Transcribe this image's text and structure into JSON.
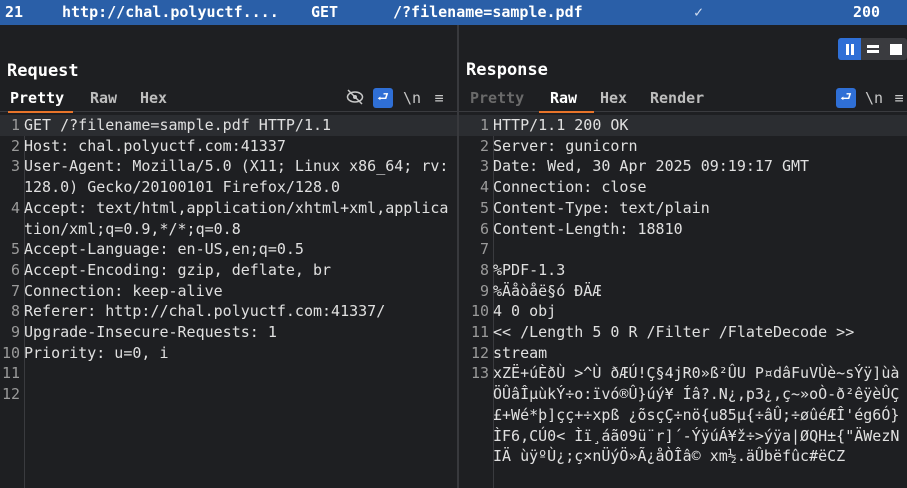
{
  "history_row": {
    "id": "21",
    "host": "http://chal.polyuctf....",
    "method": "GET",
    "url": "/?filename=sample.pdf",
    "status": "200"
  },
  "request": {
    "title": "Request",
    "tabs": [
      "Pretty",
      "Raw",
      "Hex"
    ],
    "newline_label": "\\n",
    "lines": [
      {
        "n": "1",
        "text": "GET /?filename=sample.pdf HTTP/1.1"
      },
      {
        "n": "2",
        "text": "Host: chal.polyuctf.com:41337"
      },
      {
        "n": "3",
        "text": "User-Agent: Mozilla/5.0 (X11; Linux x86_64; rv:128.0) Gecko/20100101 Firefox/128.0"
      },
      {
        "n": "4",
        "text": "Accept: text/html,application/xhtml+xml,application/xml;q=0.9,*/*;q=0.8"
      },
      {
        "n": "5",
        "text": "Accept-Language: en-US,en;q=0.5"
      },
      {
        "n": "6",
        "text": "Accept-Encoding: gzip, deflate, br"
      },
      {
        "n": "7",
        "text": "Connection: keep-alive"
      },
      {
        "n": "8",
        "text": "Referer: http://chal.polyuctf.com:41337/"
      },
      {
        "n": "9",
        "text": "Upgrade-Insecure-Requests: 1"
      },
      {
        "n": "10",
        "text": "Priority: u=0, i"
      },
      {
        "n": "11",
        "text": ""
      },
      {
        "n": "12",
        "text": ""
      }
    ]
  },
  "response": {
    "title": "Response",
    "tabs": [
      "Pretty",
      "Raw",
      "Hex",
      "Render"
    ],
    "newline_label": "\\n",
    "lines": [
      {
        "n": "1",
        "text": "HTTP/1.1 200 OK"
      },
      {
        "n": "2",
        "text": "Server: gunicorn"
      },
      {
        "n": "3",
        "text": "Date: Wed, 30 Apr 2025 09:19:17 GMT"
      },
      {
        "n": "4",
        "text": "Connection: close"
      },
      {
        "n": "5",
        "text": "Content-Type: text/plain"
      },
      {
        "n": "6",
        "text": "Content-Length: 18810"
      },
      {
        "n": "7",
        "text": ""
      },
      {
        "n": "8",
        "text": "%PDF-1.3"
      },
      {
        "n": "9",
        "text": "%Äåòåë§ó ÐÄÆ"
      },
      {
        "n": "10",
        "text": "4 0 obj"
      },
      {
        "n": "11",
        "text": "<< /Length 5 0 R /Filter /FlateDecode >>"
      },
      {
        "n": "12",
        "text": "stream"
      },
      {
        "n": "13",
        "text": "xZË+úÈðÙ >^Ù ðÆÚ!Ç§4jR0»ß²ÛU P¤dâFuVÙè~sÝÿ]ùàÖÛâÎµùkÝ÷o:ïvó®Û}úý¥ Íâ?.N¿,p3¿,ç~»oÒ-ð²êÿèÛÇ£+Wé*þ]çç+÷xpß ¿õsçÇ÷nö{u85µ{÷âÛ;÷øûéÆÎ'ég6Ó}ÌF6,CÚ0< Ìï¸áã09ü¨r]´-ÝÿúÁ¥ž÷>ýÿa|ØQH±{\"ÄWezNIÄ ùÿºÙ¿;ç×nÜýÖ»Ã¿åÒÎâ© xm½.äÛbëfûc#ëCZ"
      }
    ]
  }
}
